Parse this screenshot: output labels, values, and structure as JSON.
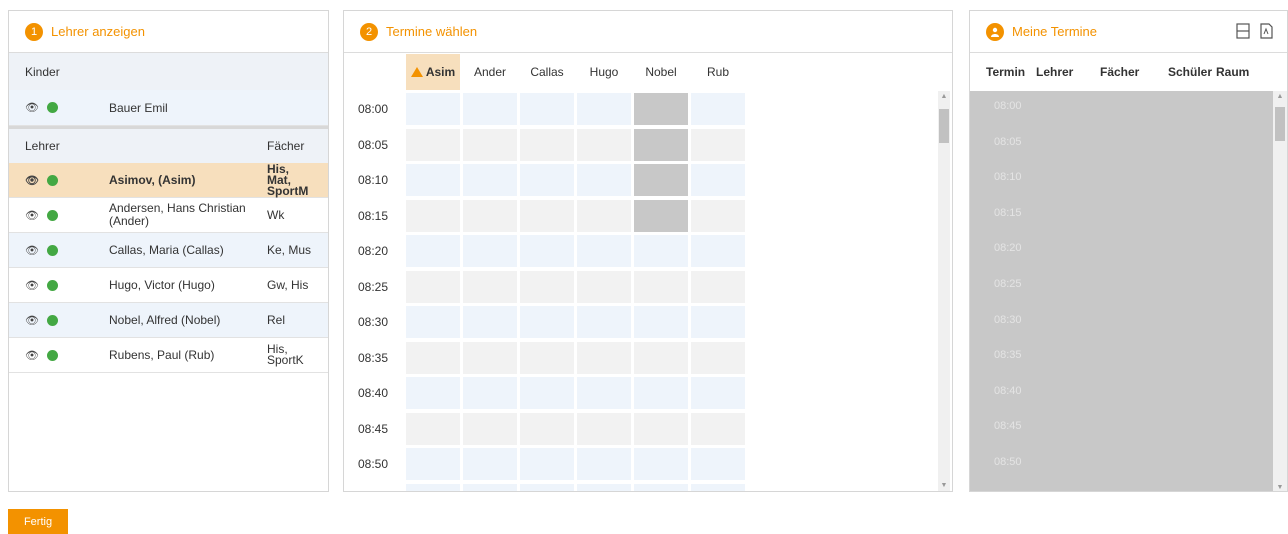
{
  "panel1": {
    "step": "1",
    "title": "Lehrer anzeigen",
    "kinder_heading": "Kinder",
    "kinder": [
      {
        "name": "Bauer Emil"
      }
    ],
    "lehrer_heading": "Lehrer",
    "faecher_heading": "Fächer",
    "lehrer": [
      {
        "name": "Asimov, (Asim)",
        "subjects": [
          "His,",
          "Mat,",
          "SportM"
        ],
        "selected": true
      },
      {
        "name_lines": [
          "Andersen, Hans Christian",
          "(Ander)"
        ],
        "subjects": [
          "Wk"
        ]
      },
      {
        "name": "Callas, Maria (Callas)",
        "subjects": [
          "Ke, Mus"
        ]
      },
      {
        "name": "Hugo, Victor (Hugo)",
        "subjects": [
          "Gw, His"
        ]
      },
      {
        "name": "Nobel, Alfred (Nobel)",
        "subjects": [
          "Rel"
        ]
      },
      {
        "name": "Rubens, Paul (Rub)",
        "subjects": [
          "His,",
          "SportK"
        ]
      }
    ]
  },
  "panel2": {
    "step": "2",
    "title": "Termine wählen",
    "tabs": [
      "Asim",
      "Ander",
      "Callas",
      "Hugo",
      "Nobel",
      "Rub"
    ],
    "active_tab": "Asim",
    "times": [
      "08:00",
      "08:05",
      "08:10",
      "08:15",
      "08:20",
      "08:25",
      "08:30",
      "08:35",
      "08:40",
      "08:45",
      "08:50"
    ]
  },
  "panel3": {
    "title": "Meine Termine",
    "columns": [
      "Termin",
      "Lehrer",
      "Fächer",
      "Schüler",
      "Raum"
    ],
    "times": [
      "08:00",
      "08:05",
      "08:10",
      "08:15",
      "08:20",
      "08:25",
      "08:30",
      "08:35",
      "08:40",
      "08:45",
      "08:50"
    ]
  },
  "footer": {
    "done_label": "Fertig"
  },
  "colors": {
    "accent": "#f39200",
    "available": "#43a843",
    "selected_row": "#f7dfbd",
    "blocked_cell": "#c8c8c8"
  }
}
